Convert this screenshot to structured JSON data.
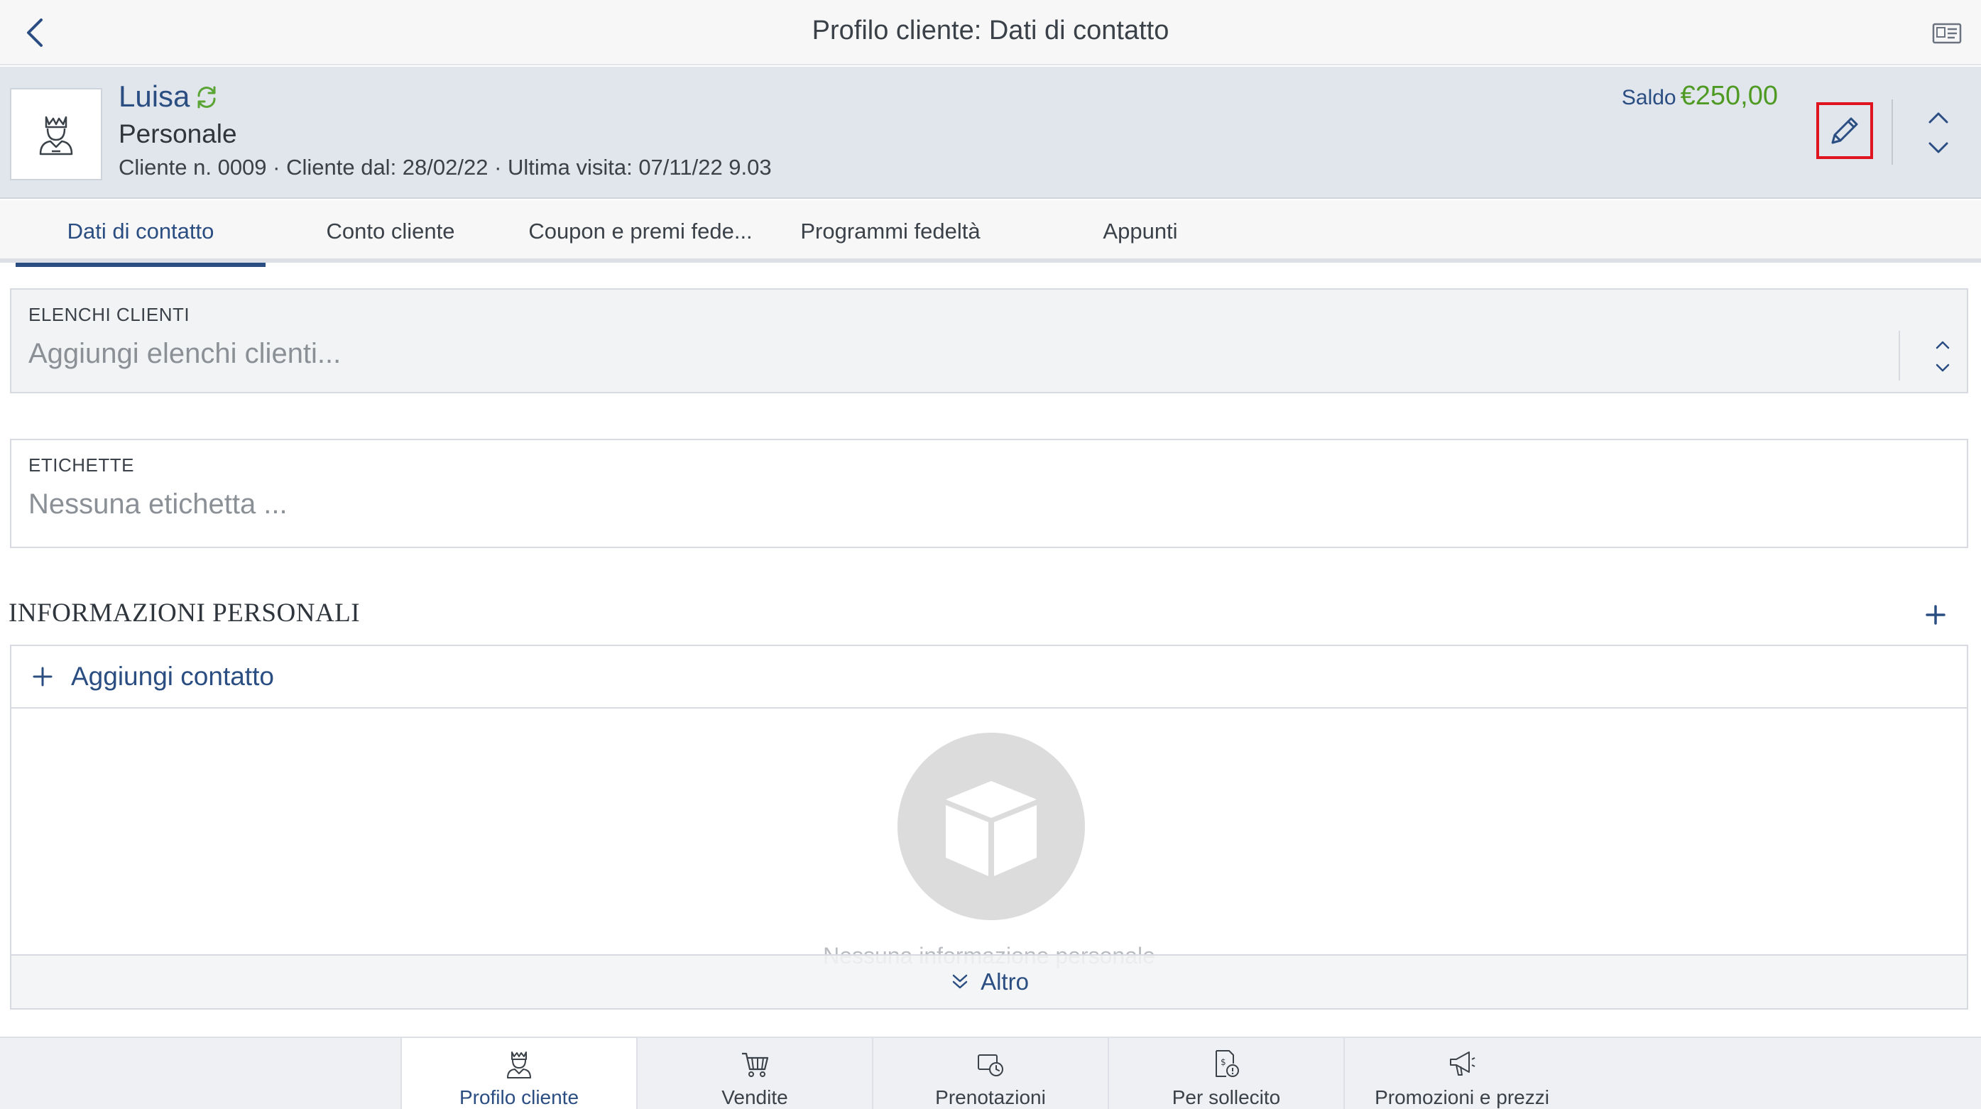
{
  "topbar": {
    "title": "Profilo cliente: Dati di contatto",
    "back_icon": "chevron-left-icon",
    "card_icon": "id-card-icon"
  },
  "customer": {
    "name": "Luisa",
    "type": "Personale",
    "meta": "Cliente n. 0009 · Cliente dal: 28/02/22 · Ultima visita: 07/11/22 9.03",
    "saldo_label": "Saldo",
    "saldo_amount": "€250,00",
    "saldo_color": "#4e9a22"
  },
  "tabs": [
    {
      "label": "Dati di contatto",
      "active": true
    },
    {
      "label": "Conto cliente",
      "active": false
    },
    {
      "label": "Coupon e premi fede...",
      "active": false
    },
    {
      "label": "Programmi fedeltà",
      "active": false
    },
    {
      "label": "Appunti",
      "active": false
    }
  ],
  "fields": {
    "lists_label": "ELENCHI CLIENTI",
    "lists_placeholder": "Aggiungi elenchi clienti...",
    "tags_label": "ETICHETTE",
    "tags_placeholder": "Nessuna etichetta ..."
  },
  "personal_info": {
    "title": "INFORMAZIONI PERSONALI",
    "add_contact": "Aggiungi contatto",
    "empty_text": "Nessuna informazione personale",
    "more": "Altro"
  },
  "bottom_nav": [
    {
      "label": "Profilo cliente",
      "icon": "customer-profile-icon",
      "active": true
    },
    {
      "label": "Vendite",
      "icon": "cart-icon",
      "active": false
    },
    {
      "label": "Prenotazioni",
      "icon": "reservation-icon",
      "active": false
    },
    {
      "label": "Per sollecito",
      "icon": "reminder-icon",
      "active": false
    },
    {
      "label": "Promozioni e prezzi",
      "icon": "megaphone-icon",
      "active": false
    }
  ],
  "colors": {
    "accent": "#2a4d82",
    "highlight_border": "#e0141f"
  }
}
